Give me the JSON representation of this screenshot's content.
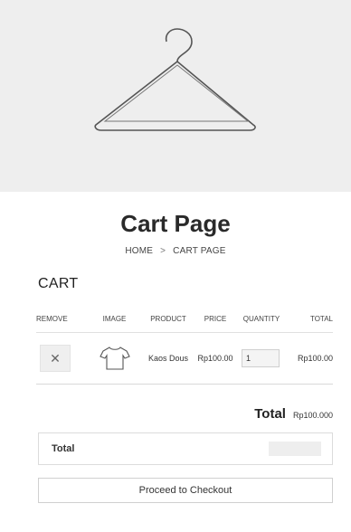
{
  "hero": {
    "icon": "hanger-icon",
    "background": "#eeeeee"
  },
  "page": {
    "title": "Cart Page"
  },
  "breadcrumb": {
    "home": "HOME",
    "separator": ">",
    "current": "CART PAGE"
  },
  "cart": {
    "heading": "CART",
    "columns": [
      "REMOVE",
      "IMAGE",
      "PRODUCT",
      "PRICE",
      "QUANTITY",
      "TOTAL"
    ],
    "rows": [
      {
        "remove_icon": "close-icon",
        "image_icon": "tshirt-icon",
        "product": "Kaos Dous",
        "price": "Rp100.00",
        "quantity": "1",
        "total": "Rp100.00"
      }
    ]
  },
  "summary": {
    "label": "Total",
    "value": "Rp100.000"
  },
  "totals_box": {
    "label": "Total"
  },
  "checkout": {
    "label": "Proceed to Checkout"
  }
}
